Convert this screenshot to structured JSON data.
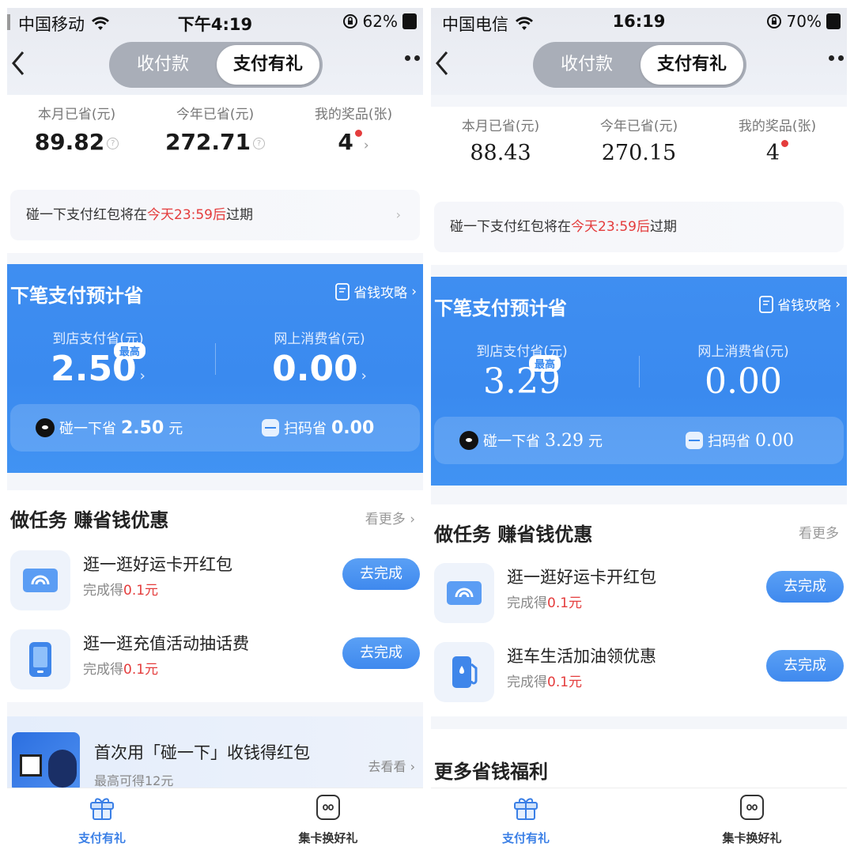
{
  "left": {
    "status": {
      "carrier": "中国移动",
      "time": "下午4:19",
      "battery": "62%"
    },
    "nav": {
      "tab_collect": "收付款",
      "tab_gift": "支付有礼"
    },
    "savings": {
      "month_label": "本月已省(元)",
      "month_value": "89.82",
      "year_label": "今年已省(元)",
      "year_value": "272.71",
      "prizes_label": "我的奖品(张)",
      "prizes_value": "4"
    },
    "expire": {
      "prefix": "碰一下支付红包将在",
      "highlight": "今天23:59后",
      "suffix": "过期"
    },
    "next": {
      "title": "下笔支付预计省",
      "guide": "省钱攻略",
      "store_label": "到店支付省(元)",
      "store_value": "2.50",
      "badge": "最高",
      "online_label": "网上消费省(元)",
      "online_value": "0.00",
      "tap_label": "碰一下省",
      "tap_value": "2.50",
      "tap_unit": "元",
      "scan_label": "扫码省",
      "scan_value": "0.00"
    },
    "tasks": {
      "heading": "做任务 赚省钱优惠",
      "more": "看更多",
      "items": [
        {
          "title": "逛一逛好运卡开红包",
          "sub_prefix": "完成得",
          "reward": "0.1元",
          "button": "去完成",
          "icon": "card-wave-icon"
        },
        {
          "title": "逛一逛充值活动抽话费",
          "sub_prefix": "完成得",
          "reward": "0.1元",
          "button": "去完成",
          "icon": "phone-icon"
        }
      ]
    },
    "promo": {
      "title": "首次用「碰一下」收钱得红包",
      "sub": "最高可得12元",
      "go": "去看看"
    },
    "tabbar": {
      "gift": "支付有礼",
      "cards": "集卡换好礼"
    }
  },
  "right": {
    "status": {
      "carrier": "中国电信",
      "time": "16:19",
      "battery": "70%"
    },
    "nav": {
      "tab_collect": "收付款",
      "tab_gift": "支付有礼"
    },
    "savings": {
      "month_label": "本月已省(元)",
      "month_value": "88.43",
      "year_label": "今年已省(元)",
      "year_value": "270.15",
      "prizes_label": "我的奖品(张)",
      "prizes_value": "4"
    },
    "expire": {
      "prefix": "碰一下支付红包将在",
      "highlight": "今天23:59后",
      "suffix": "过期"
    },
    "next": {
      "title": "下笔支付预计省",
      "guide": "省钱攻略",
      "store_label": "到店支付省(元)",
      "store_value": "3.29",
      "badge": "最高",
      "online_label": "网上消费省(元)",
      "online_value": "0.00",
      "tap_label": "碰一下省",
      "tap_value": "3.29",
      "tap_unit": "元",
      "scan_label": "扫码省",
      "scan_value": "0.00"
    },
    "tasks": {
      "heading": "做任务 赚省钱优惠",
      "more": "看更多",
      "items": [
        {
          "title": "逛一逛好运卡开红包",
          "sub_prefix": "完成得",
          "reward": "0.1元",
          "button": "去完成",
          "icon": "card-wave-icon"
        },
        {
          "title": "逛车生活加油领优惠",
          "sub_prefix": "完成得",
          "reward": "0.1元",
          "button": "去完成",
          "icon": "fuel-icon"
        }
      ]
    },
    "more_welfare": "更多省钱福利",
    "tabbar": {
      "gift": "支付有礼",
      "cards": "集卡换好礼"
    }
  },
  "colors": {
    "accent_blue": "#3a8aef",
    "highlight_red": "#e43c3c",
    "tab_active": "#3a7fe6"
  }
}
